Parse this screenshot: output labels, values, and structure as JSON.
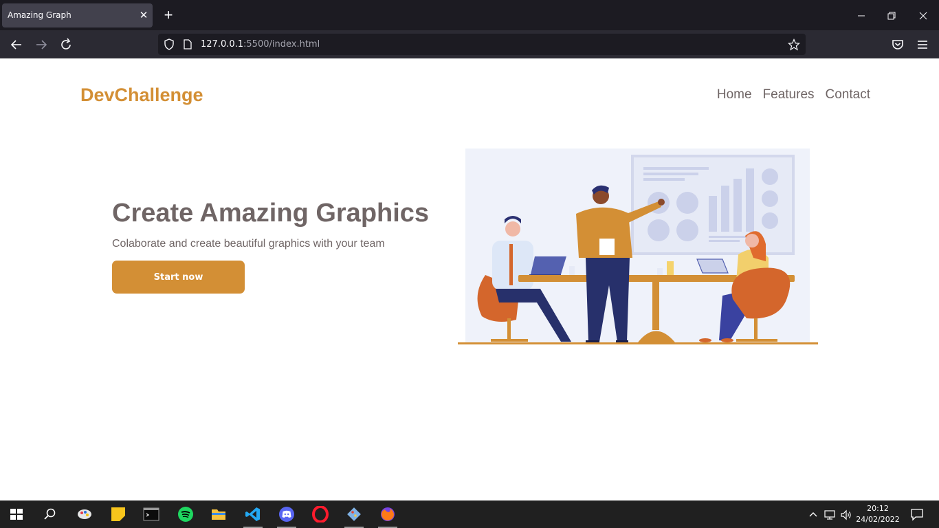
{
  "browser": {
    "tab_title": "Amazing Graph",
    "tab_close": "✕",
    "new_tab": "+",
    "url_host": "127.0.0.1",
    "url_path": ":5500/index.html"
  },
  "site": {
    "logo": "DevChallenge",
    "nav": [
      "Home",
      "Features",
      "Contact"
    ],
    "hero_title": "Create Amazing Graphics",
    "hero_subtitle": "Colaborate and create beautiful graphics with your team",
    "cta_label": "Start now"
  },
  "taskbar": {
    "time": "20:12",
    "date": "24/02/2022",
    "apps": [
      "windows-start",
      "search",
      "paint",
      "sticky-notes",
      "terminal",
      "spotify",
      "file-explorer",
      "vscode",
      "discord",
      "opera",
      "git",
      "firefox"
    ]
  },
  "colors": {
    "brand": "#d38f35",
    "text": "#6f6565",
    "chrome_dark": "#1c1b22",
    "chrome_toolbar": "#2b2a33"
  }
}
